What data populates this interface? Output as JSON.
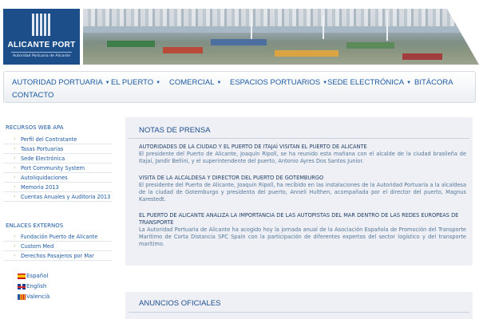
{
  "header": {
    "logo_name": "ALICANTE PORT",
    "logo_subtitle": "Autoridad Portuaria de Alicante",
    "brand_color": "#1c4e8a"
  },
  "nav": {
    "items": [
      {
        "label": "AUTORIDAD PORTUARIA",
        "dropdown": true
      },
      {
        "label": "EL PUERTO",
        "dropdown": true
      },
      {
        "label": "COMERCIAL",
        "dropdown": true
      },
      {
        "label": "ESPACIOS PORTUARIOS",
        "dropdown": true
      },
      {
        "label": "SEDE ELECTRÓNICA",
        "dropdown": true
      },
      {
        "label": "BITÁCORA",
        "dropdown": false
      },
      {
        "label": "CONTACTO",
        "dropdown": false
      }
    ],
    "caret_icon": "▼",
    "link_color": "#1e5aa0"
  },
  "sidebar": {
    "web_heading": "RECURSOS WEB APA",
    "web_links": [
      "Perfil del Contratante",
      "Tasas Portuarias",
      "Sede Electrónica",
      "Port Community System",
      "Autoliquidaciones",
      "Memoria 2013",
      "Cuentas Anuales y Auditoria 2013"
    ],
    "external_heading": "ENLACES EXTERNOS",
    "external_links": [
      "Fundación Puerto de Alicante",
      "Custom Med",
      "Derechos Pasajeros por Mar"
    ],
    "bullet_icon": "›",
    "languages": [
      {
        "label": "Español",
        "flag": "spain-flag-icon"
      },
      {
        "label": "English",
        "flag": "uk-flag-icon"
      },
      {
        "label": "Valencià",
        "flag": "valencia-flag-icon"
      }
    ]
  },
  "news": {
    "title": "NOTAS DE PRENSA",
    "articles": [
      {
        "headline": "AUTORIDADES DE LA CIUDAD Y EL PUERTO DE ITAJAÍ VISITAN EL PUERTO DE ALICANTE",
        "body": "El presidente del Puerto de Alicante, Joaquín Ripoll, se ha reunido esta mañana con el alcalde de la ciudad brasileña de Itajaí, Jandir Bellini, y el superintendente del puerto, Antonio Ayres Dos Santos Junior."
      },
      {
        "headline": "VISITA DE LA ALCALDESA Y DIRECTOR DEL PUERTO DE GOTEMBURGO",
        "body": "El presidente del Puerto de Alicante, Joaquín Ripoll, ha recibido en las instalaciones de la Autoridad Portuaria a la alcaldesa de la ciudad de Gotemburgo y presidenta del puerto, Anneli Hulthen, acompañada por el director del puerto, Magnus Karestedt."
      },
      {
        "headline": "EL PUERTO DE ALICANTE ANALIZA LA IMPORTANCIA DE LAS AUTOPISTAS DEL MAR DENTRO DE LAS REDES EUROPEAS DE TRANSPORTE",
        "body": "La Autoridad Portuaria de Alicante ha acogido hoy la jornada anual de la Asociación Española de Promoción del Transporte Marítimo de Corta Distancia SPC Spain con la participación de diferentes expertos del sector logístico y del transporte marítimo."
      }
    ]
  },
  "ads": {
    "title": "ANUNCIOS OFICIALES"
  }
}
